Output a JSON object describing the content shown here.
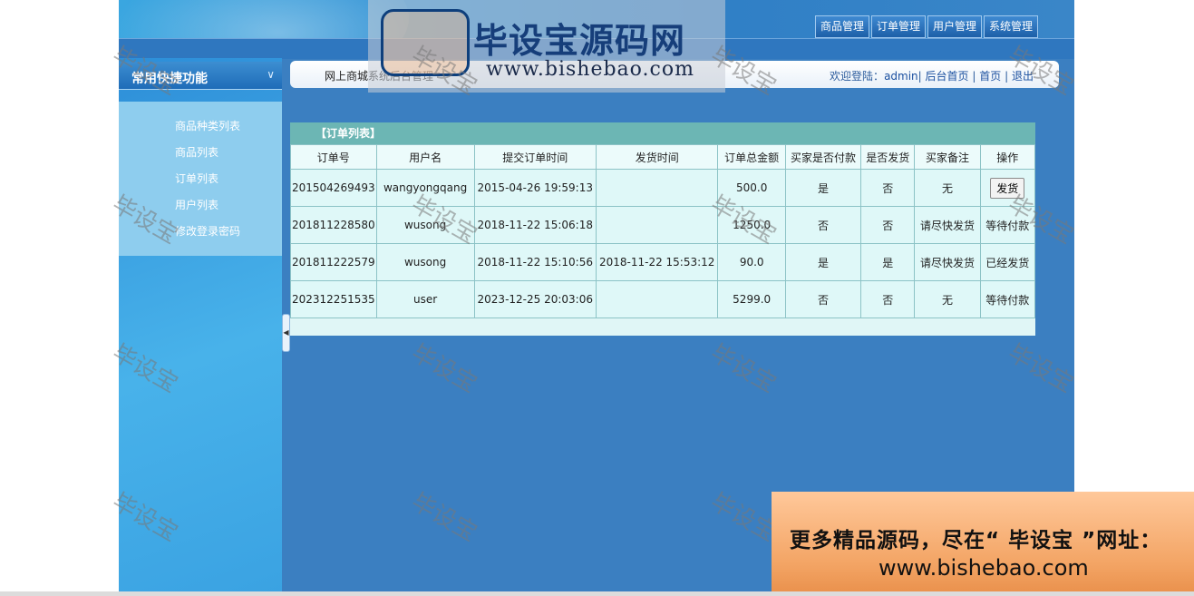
{
  "top_nav": [
    "商品管理",
    "订单管理",
    "用户管理",
    "系统管理"
  ],
  "sidebar": {
    "title": "常用快捷功能",
    "toggle_icon": "chevron-down",
    "items": [
      "商品种类列表",
      "商品列表",
      "订单列表",
      "用户列表",
      "修改登录密码"
    ]
  },
  "breadcrumb": "网上商城系统后台管理",
  "welcome": {
    "prefix": "欢迎登陆：",
    "user": "admin",
    "links": [
      "后台首页",
      "首页",
      "退出"
    ],
    "separator": "|"
  },
  "order_panel": {
    "title": "【订单列表】",
    "headers": [
      "订单号",
      "用户名",
      "提交订单时间",
      "发货时间",
      "订单总金额",
      "买家是否付款",
      "是否发货",
      "买家备注",
      "操作"
    ],
    "rows": [
      {
        "order_no": "201504269493",
        "user": "wangyongqang",
        "submit_time": "2015-04-26 19:59:13",
        "ship_time": "",
        "total": "500.0",
        "paid": "是",
        "shipped": "否",
        "remark": "无",
        "action": "发货",
        "action_is_button": true
      },
      {
        "order_no": "201811228580",
        "user": "wusong",
        "submit_time": "2018-11-22 15:06:18",
        "ship_time": "",
        "total": "1250.0",
        "paid": "否",
        "shipped": "否",
        "remark": "请尽快发货",
        "action": "等待付款",
        "action_is_button": false
      },
      {
        "order_no": "201811222579",
        "user": "wusong",
        "submit_time": "2018-11-22 15:10:56",
        "ship_time": "2018-11-22 15:53:12",
        "total": "90.0",
        "paid": "是",
        "shipped": "是",
        "remark": "请尽快发货",
        "action": "已经发货",
        "action_is_button": false
      },
      {
        "order_no": "202312251535",
        "user": "user",
        "submit_time": "2023-12-25 20:03:06",
        "ship_time": "",
        "total": "5299.0",
        "paid": "否",
        "shipped": "否",
        "remark": "无",
        "action": "等待付款",
        "action_is_button": false
      }
    ]
  },
  "watermark": {
    "logo_name": "毕设宝源码网",
    "logo_seal_text": "毕设宝",
    "logo_url": "www.bishebao.com",
    "tile_text": "毕设宝",
    "promo_line1": "更多精品源码，尽在“ 毕设宝 ”网址：",
    "promo_line2": "www.bishebao.com"
  }
}
